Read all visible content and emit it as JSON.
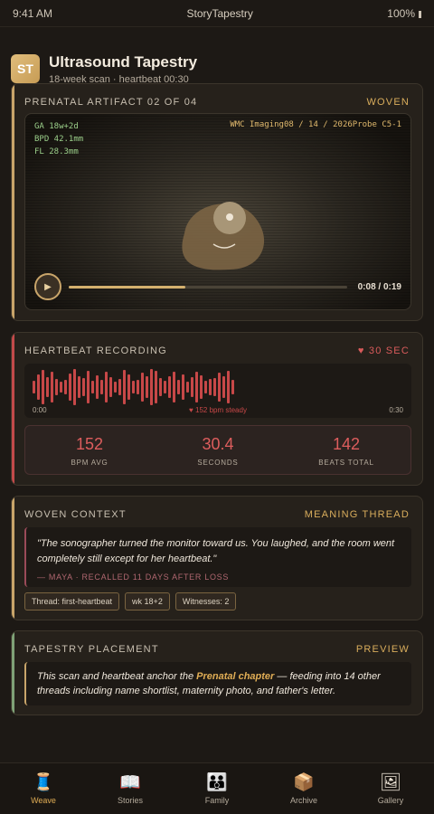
{
  "status": {
    "time": "9:41 AM",
    "app": "StoryTapestry",
    "battery": "100%"
  },
  "header": {
    "logo": "ST",
    "title": "Ultrasound Tapestry",
    "subtitle": "18-week scan · heartbeat 00:30"
  },
  "artifact": {
    "label": "PRENATAL ARTIFACT 02 OF 04",
    "tag": "WOVEN",
    "meta_left": [
      "GA 18w+2d",
      "BPD 42.1mm",
      "FL 28.3mm"
    ],
    "meta_right": "WMC Imaging08 / 14 / 2026Probe C5-1",
    "play_icon": "play-icon",
    "progress": 0.42,
    "time": "0:08 / 0:19"
  },
  "heartbeat": {
    "label": "HEARTBEAT RECORDING",
    "tag": "♥ 30 SEC",
    "wave_start": "0:00",
    "wave_mid": "♥ 152 bpm steady",
    "wave_end": "0:30",
    "wave_levels": [
      0.35,
      0.7,
      0.95,
      0.55,
      0.85,
      0.45,
      0.3,
      0.4,
      0.75,
      1.0,
      0.6,
      0.5,
      0.9,
      0.35,
      0.65,
      0.4,
      0.85,
      0.55,
      0.3,
      0.45,
      0.95,
      0.7,
      0.35,
      0.4,
      0.8,
      0.6,
      1.0,
      0.9,
      0.5,
      0.35,
      0.6,
      0.85,
      0.4,
      0.7,
      0.3,
      0.55,
      0.85,
      0.65,
      0.35,
      0.45,
      0.5,
      0.8,
      0.6,
      0.9,
      0.4
    ],
    "stats": [
      {
        "value": "152",
        "label": "BPM AVG"
      },
      {
        "value": "30.4",
        "label": "SECONDS"
      },
      {
        "value": "142",
        "label": "BEATS TOTAL"
      }
    ]
  },
  "context": {
    "label": "WOVEN CONTEXT",
    "tag": "MEANING THREAD",
    "quote": "\"The sonographer turned the monitor toward us. You laughed, and the room went completely still except for her heartbeat.\"",
    "attribution": "— MAYA · RECALLED 11 DAYS AFTER LOSS",
    "chips": [
      "Thread: first-heartbeat",
      "wk 18+2",
      "Witnesses: 2"
    ]
  },
  "placement": {
    "label": "TAPESTRY PLACEMENT",
    "tag": "PREVIEW",
    "text_before": "This scan and heartbeat anchor the ",
    "highlight": "Prenatal chapter",
    "text_after": " — feeding into 14 other threads including name shortlist, maternity photo, and father's letter."
  },
  "nav": [
    {
      "label": "Weave",
      "icon": "🧵",
      "icon_name": "spool-icon"
    },
    {
      "label": "Stories",
      "icon": "📖",
      "icon_name": "book-icon"
    },
    {
      "label": "Family",
      "icon": "👪",
      "icon_name": "family-icon"
    },
    {
      "label": "Archive",
      "icon": "📦",
      "icon_name": "box-icon"
    },
    {
      "label": "Gallery",
      "icon": "🖼",
      "icon_name": "picture-icon"
    }
  ],
  "colors": {
    "accent": "#d9ad5c",
    "heart": "#c74848",
    "background": "#1d1915"
  }
}
